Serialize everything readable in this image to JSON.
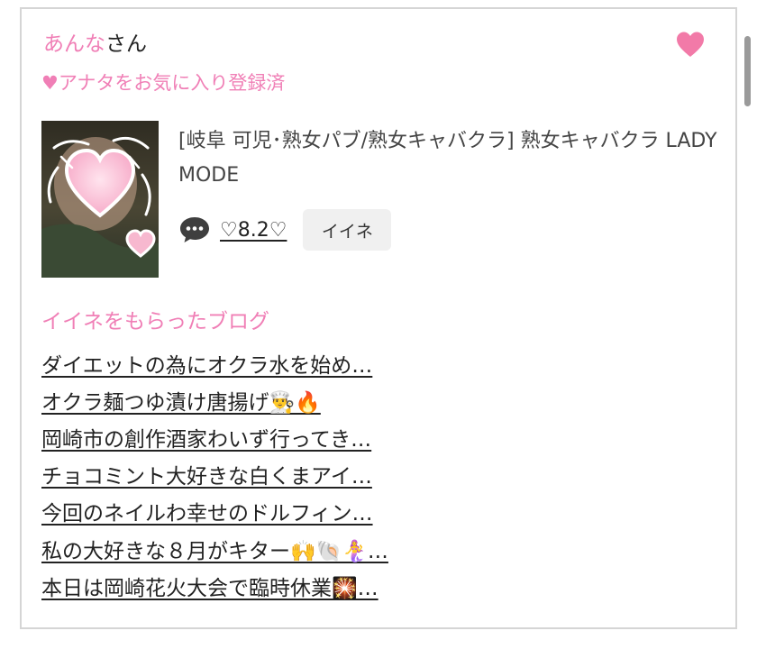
{
  "profile": {
    "name": "あんな",
    "honorific": "さん",
    "favorite_status": "♥アナタをお気に入り登録済",
    "shop_name": "[岐阜 可児･熟女パブ/熟女キャバクラ]  熟女キャバクラ LADY MODE",
    "score": "♡8.2♡",
    "iine_label": "イイネ"
  },
  "blogs": {
    "heading": "イイネをもらったブログ",
    "items": [
      "ダイエットの為にオクラ水を始め…",
      "オクラ麺つゆ漬け唐揚げ👨‍🍳🔥",
      "岡崎市の創作酒家わいず行ってき…",
      "チョコミント大好きな白くまアイ…",
      "今回のネイルわ幸せのドルフィン…",
      "私の大好きな８月がキター🙌🐚🧜‍♀️…",
      "本日は岡崎花火大会で臨時休業🎇…"
    ]
  },
  "icons": {
    "favorite": "heart-icon",
    "comment": "chat-bubble-icon"
  },
  "colors": {
    "accent_pink": "#f07fb6",
    "heart": "#f27aa8",
    "text": "#222222",
    "card_border": "#d5d5d5",
    "button_bg": "#f0f0f0"
  }
}
